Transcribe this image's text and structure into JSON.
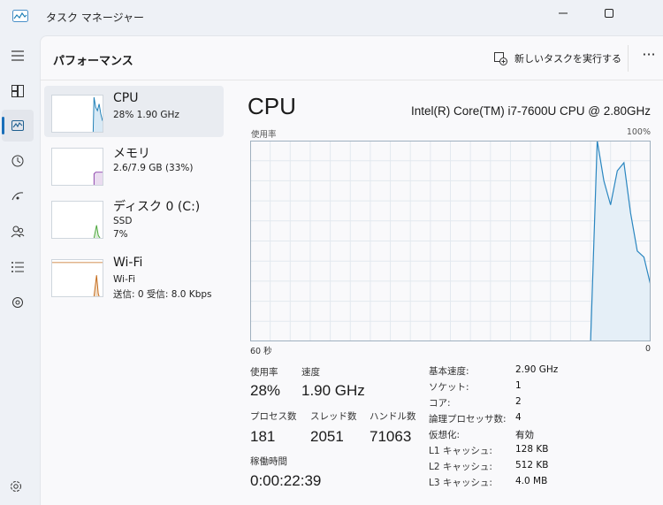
{
  "window": {
    "title": "タスク マネージャー"
  },
  "header": {
    "title": "パフォーマンス",
    "new_task_label": "新しいタスクを実行する",
    "more_label": "···"
  },
  "rail": {
    "items": [
      "menu-icon",
      "processes-icon",
      "performance-icon",
      "history-icon",
      "startup-icon",
      "users-icon",
      "details-icon",
      "services-icon"
    ],
    "settings": "settings-icon",
    "active": "performance-icon"
  },
  "resources": [
    {
      "name": "CPU",
      "sub1": "28%  1.90 GHz",
      "sub2": "",
      "color": "#1f7fb6",
      "selected": true
    },
    {
      "name": "メモリ",
      "sub1": "2.6/7.9 GB (33%)",
      "sub2": "",
      "color": "#8e44ad",
      "selected": false
    },
    {
      "name": "ディスク 0 (C:)",
      "sub1": "SSD",
      "sub2": "7%",
      "color": "#4aa63a",
      "selected": false
    },
    {
      "name": "Wi-Fi",
      "sub1": "Wi-Fi",
      "sub2": "送信: 0  受信: 8.0 Kbps",
      "color": "#c46a1a",
      "selected": false
    }
  ],
  "detail": {
    "title": "CPU",
    "model": "Intel(R) Core(TM) i7-7600U CPU @ 2.80GHz",
    "graph_label": "使用率",
    "graph_max": "100%",
    "axis_left": "60 秒",
    "axis_right": "0",
    "stats": {
      "usage_label": "使用率",
      "usage_value": "28%",
      "speed_label": "速度",
      "speed_value": "1.90 GHz",
      "processes_label": "プロセス数",
      "processes_value": "181",
      "threads_label": "スレッド数",
      "threads_value": "2051",
      "handles_label": "ハンドル数",
      "handles_value": "71063",
      "uptime_label": "稼働時間",
      "uptime_value": "0:00:22:39"
    },
    "info": [
      {
        "key": "基本速度:",
        "value": "2.90 GHz"
      },
      {
        "key": "ソケット:",
        "value": "1"
      },
      {
        "key": "コア:",
        "value": "2"
      },
      {
        "key": "論理プロセッサ数:",
        "value": "4"
      },
      {
        "key": "仮想化:",
        "value": "有効"
      },
      {
        "key": "L1 キャッシュ:",
        "value": "128 KB"
      },
      {
        "key": "L2 キャッシュ:",
        "value": "512 KB"
      },
      {
        "key": "L3 キャッシュ:",
        "value": "4.0 MB"
      }
    ]
  },
  "chart_data": {
    "type": "area",
    "ylim": [
      0,
      100
    ],
    "xlim": [
      60,
      0
    ],
    "x": [
      60,
      9,
      8,
      7,
      6,
      5,
      4,
      3,
      2,
      1,
      0
    ],
    "series": [
      {
        "values": [
          0,
          0,
          100,
          80,
          68,
          85,
          89,
          64,
          45,
          42,
          28
        ]
      }
    ]
  }
}
